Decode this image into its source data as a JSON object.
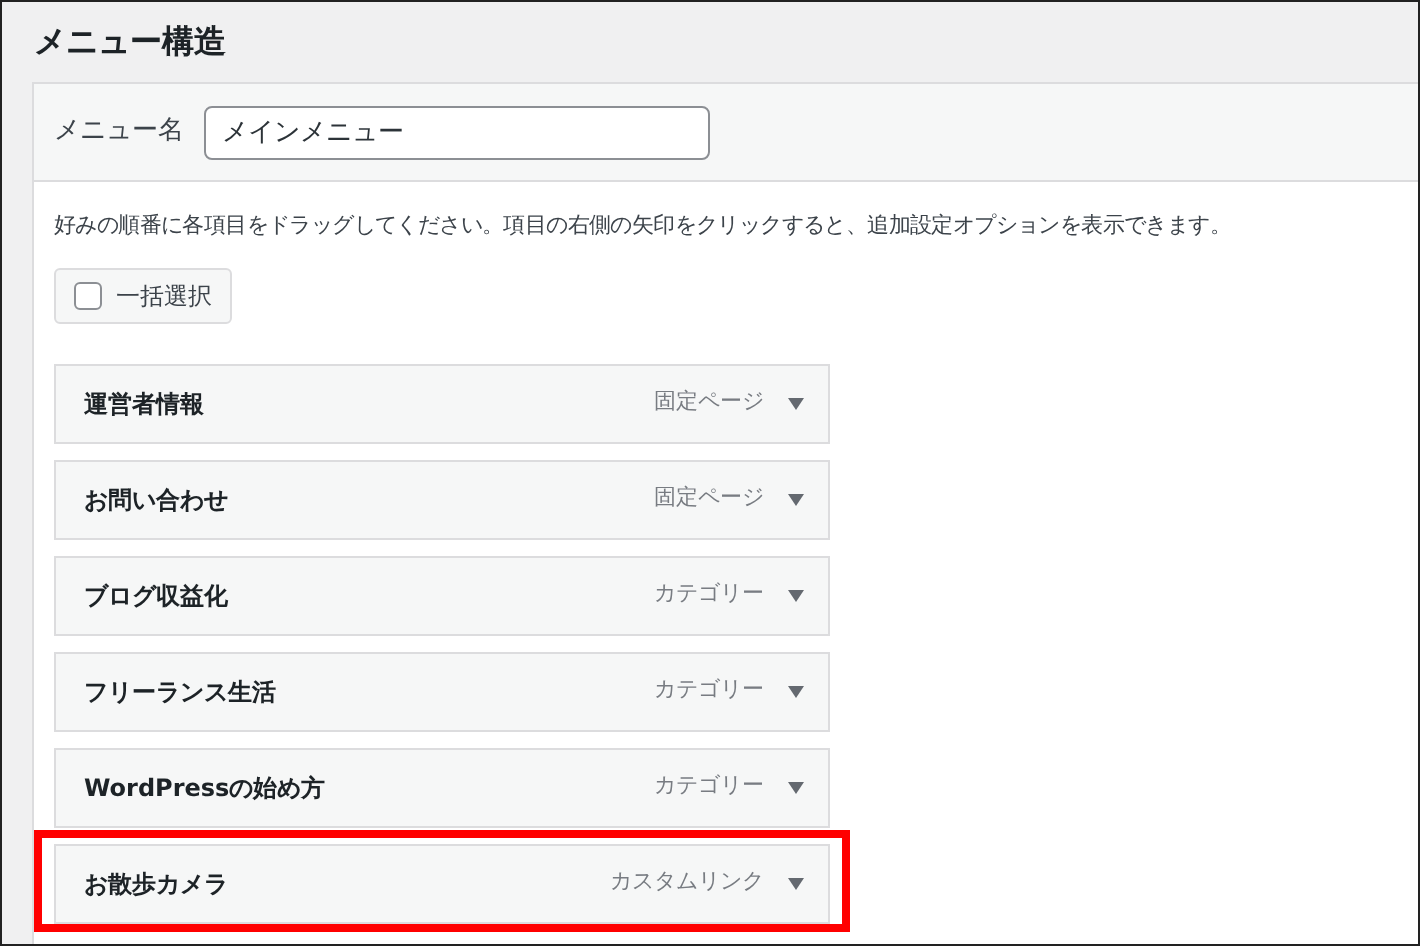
{
  "title": "メニュー構造",
  "menu_name": {
    "label": "メニュー名",
    "value": "メインメニュー"
  },
  "instructions": "好みの順番に各項目をドラッグしてください。項目の右側の矢印をクリックすると、追加設定オプションを表示できます。",
  "bulk_select": {
    "label": "一括選択",
    "checked": false
  },
  "items": [
    {
      "title": "運営者情報",
      "type": "固定ページ",
      "highlighted": false
    },
    {
      "title": "お問い合わせ",
      "type": "固定ページ",
      "highlighted": false
    },
    {
      "title": "ブログ収益化",
      "type": "カテゴリー",
      "highlighted": false
    },
    {
      "title": "フリーランス生活",
      "type": "カテゴリー",
      "highlighted": false
    },
    {
      "title": "WordPressの始め方",
      "type": "カテゴリー",
      "highlighted": false
    },
    {
      "title": "お散歩カメラ",
      "type": "カスタムリンク",
      "highlighted": true
    }
  ]
}
